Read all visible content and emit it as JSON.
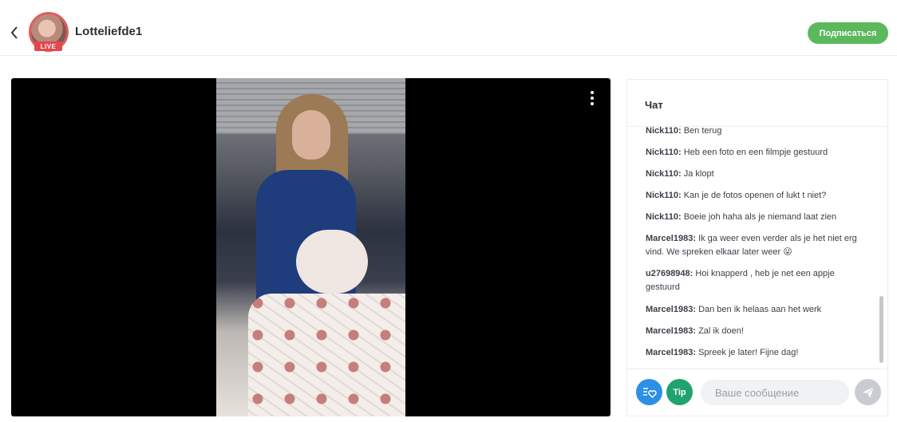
{
  "header": {
    "username": "Lotteliefde1",
    "live_badge": "LIVE",
    "subscribe_label": "Подписаться"
  },
  "chat": {
    "title": "Чат",
    "messages": [
      {
        "user": "Nick110:",
        "text": "Ben terug"
      },
      {
        "user": "Nick110:",
        "text": "Heb een foto en een filmpje gestuurd"
      },
      {
        "user": "Nick110:",
        "text": "Ja klopt"
      },
      {
        "user": "Nick110:",
        "text": "Kan je de fotos openen of lukt t niet?"
      },
      {
        "user": "Nick110:",
        "text": "Boeie joh haha als je niemand laat zien"
      },
      {
        "user": "Marcel1983:",
        "text": "Ik ga weer even verder als je het niet erg vind. We spreken elkaar later weer 😜"
      },
      {
        "user": "u27698948:",
        "text": "Hoi knapperd , heb je net een appje gestuurd"
      },
      {
        "user": "Marcel1983:",
        "text": "Dan ben ik helaas aan het werk"
      },
      {
        "user": "Marcel1983:",
        "text": "Zal ik doen!"
      },
      {
        "user": "Marcel1983:",
        "text": "Spreek je later! Fijne dag!"
      }
    ],
    "tip_label": "Tip",
    "input_placeholder": "Ваше сообщение"
  },
  "colors": {
    "subscribe": "#5cb85c",
    "live": "#e4484c",
    "fav_button": "#2b90e6",
    "tip_button": "#1fa36f"
  },
  "icons": {
    "back": "chevron-left-icon",
    "menu": "kebab-menu-icon",
    "fav": "heart-list-icon",
    "send": "paper-plane-icon"
  }
}
